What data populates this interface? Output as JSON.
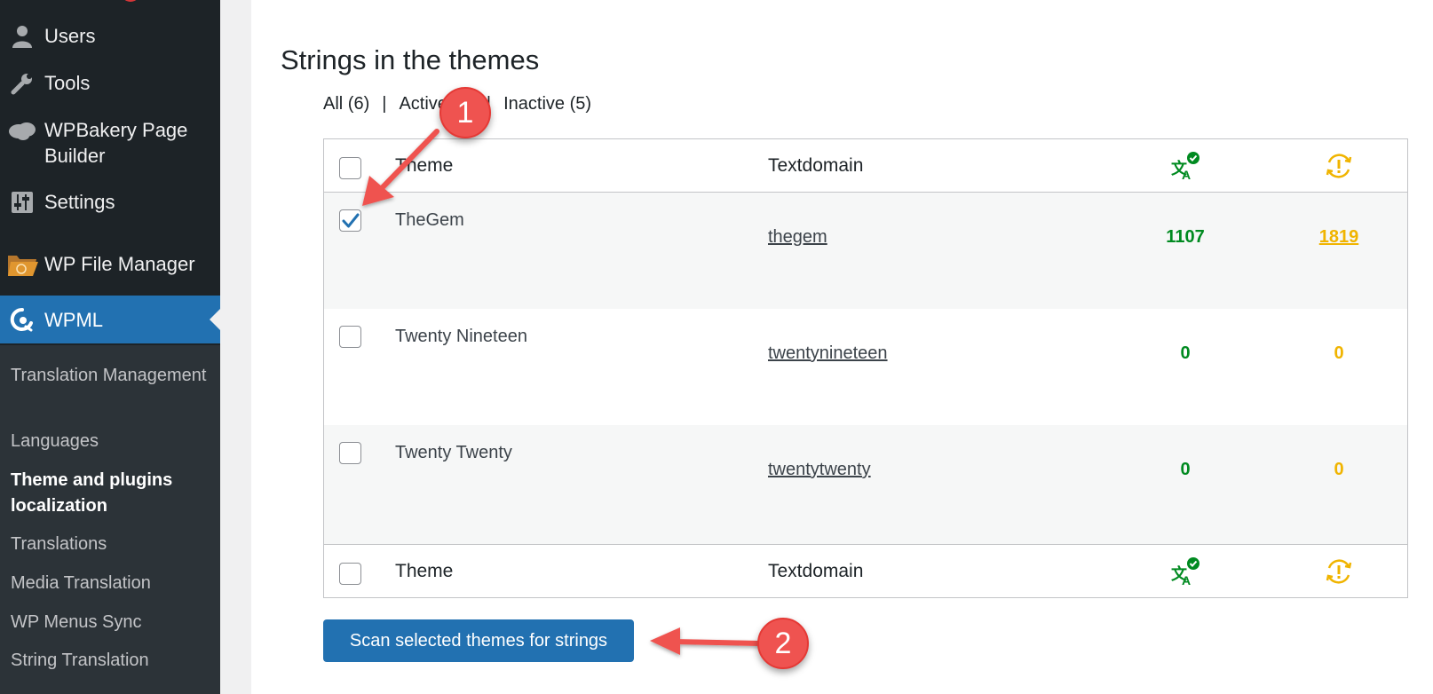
{
  "sidebar": {
    "items": [
      {
        "label": "Users",
        "icon": "user-icon"
      },
      {
        "label": "Tools",
        "icon": "wrench-icon"
      },
      {
        "label": "WPBakery Page Builder",
        "icon": "cloud-icon"
      },
      {
        "label": "Settings",
        "icon": "sliders-icon"
      },
      {
        "label": "WP File Manager",
        "icon": "folder-icon"
      },
      {
        "label": "WPML",
        "icon": "wpml-icon"
      }
    ],
    "submenu": [
      "Translation Management",
      "Languages",
      "Theme and plugins localization",
      "Translations",
      "Media Translation",
      "WP Menus Sync",
      "String Translation"
    ]
  },
  "main": {
    "title": "Strings in the themes",
    "filters": {
      "all": "All (6)",
      "active": "Active (1)",
      "inactive": "Inactive (5)",
      "separator": "|"
    },
    "table": {
      "columns": {
        "theme": "Theme",
        "textdomain": "Textdomain",
        "translated_icon": "translation-check-icon",
        "needs_update_icon": "sync-warning-icon"
      },
      "rows": [
        {
          "theme": "TheGem",
          "textdomain": "thegem",
          "translated": "1107",
          "needs_update": "1819",
          "checked": true
        },
        {
          "theme": "Twenty Nineteen",
          "textdomain": "twentynineteen",
          "translated": "0",
          "needs_update": "0",
          "checked": false
        },
        {
          "theme": "Twenty Twenty",
          "textdomain": "twentytwenty",
          "translated": "0",
          "needs_update": "0",
          "checked": false
        }
      ]
    },
    "scan_button": "Scan selected themes for strings"
  },
  "annotations": {
    "callout_1": "1",
    "callout_2": "2"
  },
  "colors": {
    "sidebar": "#1d2327",
    "submenu": "#2c3338",
    "accent": "#2271b1",
    "translated": "#008a20",
    "needs_update": "#f0b400",
    "callout": "#ef5350"
  }
}
